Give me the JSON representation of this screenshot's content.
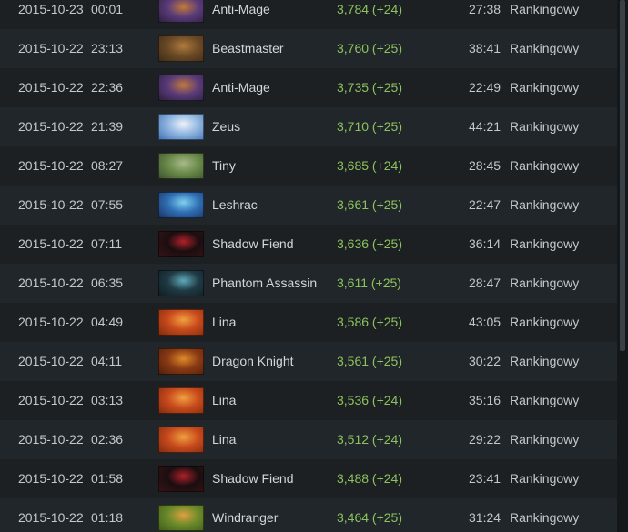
{
  "match_history": {
    "rows": [
      {
        "date": "2015-10-23",
        "time": "00:01",
        "hero": "Anti-Mage",
        "hero_icon": "anti-mage-portrait",
        "mmr": "3,784 (+24)",
        "duration": "27:38",
        "lobby": "Rankingowy"
      },
      {
        "date": "2015-10-22",
        "time": "23:13",
        "hero": "Beastmaster",
        "hero_icon": "beastmaster-portrait",
        "mmr": "3,760 (+25)",
        "duration": "38:41",
        "lobby": "Rankingowy"
      },
      {
        "date": "2015-10-22",
        "time": "22:36",
        "hero": "Anti-Mage",
        "hero_icon": "anti-mage-portrait",
        "mmr": "3,735 (+25)",
        "duration": "22:49",
        "lobby": "Rankingowy"
      },
      {
        "date": "2015-10-22",
        "time": "21:39",
        "hero": "Zeus",
        "hero_icon": "zeus-portrait",
        "mmr": "3,710 (+25)",
        "duration": "44:21",
        "lobby": "Rankingowy"
      },
      {
        "date": "2015-10-22",
        "time": "08:27",
        "hero": "Tiny",
        "hero_icon": "tiny-portrait",
        "mmr": "3,685 (+24)",
        "duration": "28:45",
        "lobby": "Rankingowy"
      },
      {
        "date": "2015-10-22",
        "time": "07:55",
        "hero": "Leshrac",
        "hero_icon": "leshrac-portrait",
        "mmr": "3,661 (+25)",
        "duration": "22:47",
        "lobby": "Rankingowy"
      },
      {
        "date": "2015-10-22",
        "time": "07:11",
        "hero": "Shadow Fiend",
        "hero_icon": "shadow-fiend-portrait",
        "mmr": "3,636 (+25)",
        "duration": "36:14",
        "lobby": "Rankingowy"
      },
      {
        "date": "2015-10-22",
        "time": "06:35",
        "hero": "Phantom Assassin",
        "hero_icon": "phantom-assassin-portrait",
        "mmr": "3,611 (+25)",
        "duration": "28:47",
        "lobby": "Rankingowy"
      },
      {
        "date": "2015-10-22",
        "time": "04:49",
        "hero": "Lina",
        "hero_icon": "lina-portrait",
        "mmr": "3,586 (+25)",
        "duration": "43:05",
        "lobby": "Rankingowy"
      },
      {
        "date": "2015-10-22",
        "time": "04:11",
        "hero": "Dragon Knight",
        "hero_icon": "dragon-knight-portrait",
        "mmr": "3,561 (+25)",
        "duration": "30:22",
        "lobby": "Rankingowy"
      },
      {
        "date": "2015-10-22",
        "time": "03:13",
        "hero": "Lina",
        "hero_icon": "lina-portrait",
        "mmr": "3,536 (+24)",
        "duration": "35:16",
        "lobby": "Rankingowy"
      },
      {
        "date": "2015-10-22",
        "time": "02:36",
        "hero": "Lina",
        "hero_icon": "lina-portrait",
        "mmr": "3,512 (+24)",
        "duration": "29:22",
        "lobby": "Rankingowy"
      },
      {
        "date": "2015-10-22",
        "time": "01:58",
        "hero": "Shadow Fiend",
        "hero_icon": "shadow-fiend-portrait",
        "mmr": "3,488 (+24)",
        "duration": "23:41",
        "lobby": "Rankingowy"
      },
      {
        "date": "2015-10-22",
        "time": "01:18",
        "hero": "Windranger",
        "hero_icon": "windranger-portrait",
        "mmr": "3,464 (+25)",
        "duration": "31:24",
        "lobby": "Rankingowy"
      }
    ]
  },
  "colors": {
    "background": "#181c1f",
    "row_odd": "#1c2023",
    "row_even": "#21262a",
    "text": "#c3c8cc",
    "mmr_gain": "#8dc35e",
    "scrollbar_thumb": "#3a4146"
  },
  "hero_portrait_colors": {
    "anti-mage-portrait": [
      "#5a3b7a",
      "#c27a3a",
      "#2a1f3a"
    ],
    "beastmaster-portrait": [
      "#6b4a26",
      "#b07a3c",
      "#3a2a18"
    ],
    "zeus-portrait": [
      "#8fb5e0",
      "#eef3fa",
      "#3e6fb0"
    ],
    "tiny-portrait": [
      "#6a8a4a",
      "#a9b98a",
      "#3b4f2c"
    ],
    "leshrac-portrait": [
      "#2f6fb5",
      "#7fd0f0",
      "#1b2f5a"
    ],
    "shadow-fiend-portrait": [
      "#1a0e10",
      "#b0202a",
      "#3a1416"
    ],
    "phantom-assassin-portrait": [
      "#1f3a44",
      "#5fa9b8",
      "#0f1c22"
    ],
    "lina-portrait": [
      "#c84a1c",
      "#f0a040",
      "#7a2a10"
    ],
    "dragon-knight-portrait": [
      "#8a3a14",
      "#e08a2a",
      "#4a1e0c"
    ],
    "windranger-portrait": [
      "#6a8a2a",
      "#e0a040",
      "#3e5a1a"
    ]
  },
  "scrollbar": {
    "position_fraction": 0.0,
    "visible_fraction": 0.66
  }
}
